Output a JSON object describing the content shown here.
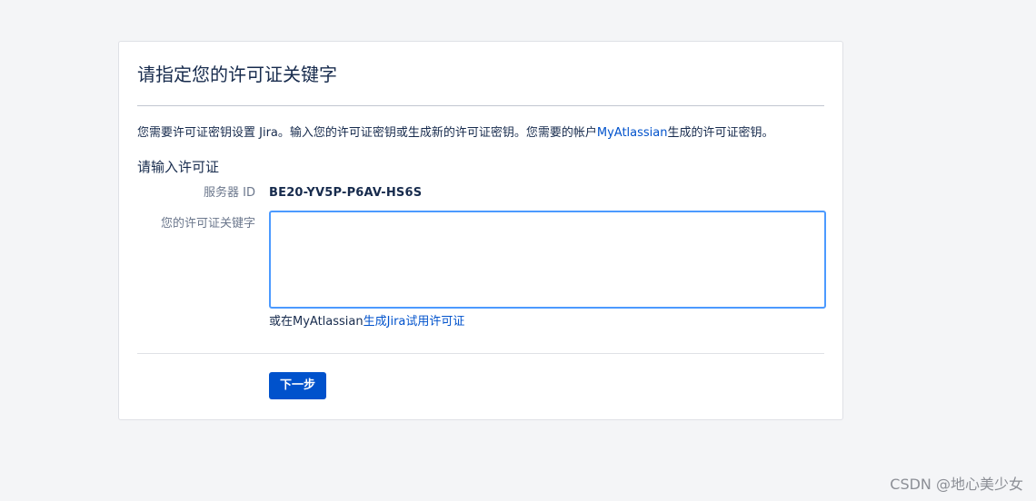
{
  "page": {
    "title": "请指定您的许可证关键字"
  },
  "intro": {
    "text_before": "您需要许可证密钥设置 Jira。输入您的许可证密钥或生成新的许可证密钥。您需要的帐户",
    "link_text": "MyAtlassian",
    "text_after": "生成的许可证密钥。"
  },
  "form": {
    "section_heading": "请输入许可证",
    "server_id_label": "服务器 ID",
    "server_id_value": "BE20-YV5P-P6AV-HS6S",
    "license_key_label": "您的许可证关键字",
    "license_key_value": "",
    "trial_prefix": "或在MyAtlassian",
    "trial_link_text": "生成Jira试用许可证",
    "next_button_label": "下一步"
  },
  "colors": {
    "background": "#f4f5f7",
    "link": "#0052cc",
    "primary_button": "#0052cc",
    "focus_border": "#4c9aff"
  },
  "watermark": "CSDN @地心美少女"
}
